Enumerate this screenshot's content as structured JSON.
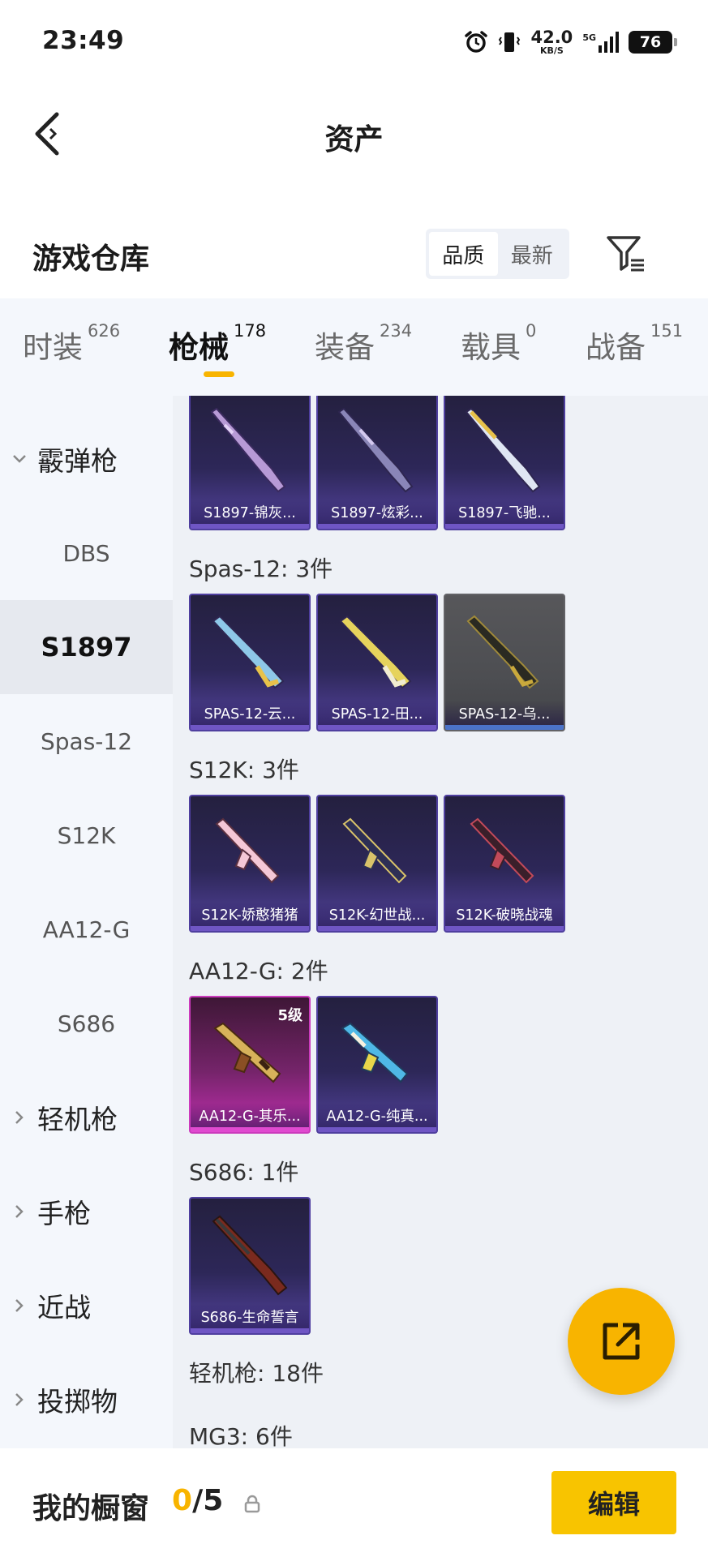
{
  "status_bar": {
    "time": "23:49",
    "net_speed_value": "42.0",
    "net_speed_unit": "KB/S",
    "network": "5G",
    "battery": "76"
  },
  "header": {
    "title": "资产"
  },
  "warehouse": {
    "title": "游戏仓库",
    "sort_options": [
      {
        "label": "品质",
        "active": true
      },
      {
        "label": "最新",
        "active": false
      }
    ]
  },
  "tabs": [
    {
      "label": "时装",
      "count": "626",
      "active": false
    },
    {
      "label": "枪械",
      "count": "178",
      "active": true
    },
    {
      "label": "装备",
      "count": "234",
      "active": false
    },
    {
      "label": "载具",
      "count": "0",
      "active": false
    },
    {
      "label": "战备",
      "count": "151",
      "active": false
    }
  ],
  "sidebar": {
    "groups": [
      {
        "label": "霰弹枪",
        "expanded": true
      },
      {
        "label": "轻机枪",
        "expanded": false
      },
      {
        "label": "手枪",
        "expanded": false
      },
      {
        "label": "近战",
        "expanded": false
      },
      {
        "label": "投掷物",
        "expanded": false
      }
    ],
    "sub_items": [
      {
        "label": "DBS",
        "selected": false
      },
      {
        "label": "S1897",
        "selected": true
      },
      {
        "label": "Spas-12",
        "selected": false
      },
      {
        "label": "S12K",
        "selected": false
      },
      {
        "label": "AA12-G",
        "selected": false
      },
      {
        "label": "S686",
        "selected": false
      }
    ]
  },
  "sections": [
    {
      "label": "",
      "items": [
        {
          "name": "S1897-锦灰...",
          "style": "purple"
        },
        {
          "name": "S1897-炫彩...",
          "style": "purple"
        },
        {
          "name": "S1897-飞驰...",
          "style": "purple"
        }
      ]
    },
    {
      "label": "Spas-12: 3件",
      "items": [
        {
          "name": "SPAS-12-云...",
          "style": "purple"
        },
        {
          "name": "SPAS-12-田...",
          "style": "purple"
        },
        {
          "name": "SPAS-12-乌...",
          "style": "gray"
        }
      ]
    },
    {
      "label": "S12K: 3件",
      "items": [
        {
          "name": "S12K-娇憨猪猪",
          "style": "purple"
        },
        {
          "name": "S12K-幻世战...",
          "style": "purple"
        },
        {
          "name": "S12K-破晓战魂",
          "style": "purple"
        }
      ]
    },
    {
      "label": "AA12-G: 2件",
      "items": [
        {
          "name": "AA12-G-其乐...",
          "style": "pink",
          "level": "5级"
        },
        {
          "name": "AA12-G-纯真...",
          "style": "purple"
        }
      ]
    },
    {
      "label": "S686: 1件",
      "items": [
        {
          "name": "S686-生命誓言",
          "style": "purple"
        }
      ]
    },
    {
      "label": "轻机枪: 18件",
      "items": []
    },
    {
      "label": "MG3: 6件",
      "items": []
    }
  ],
  "bottom_bar": {
    "showcase_label": "我的橱窗",
    "showcase_current": "0",
    "showcase_total": "/5",
    "edit_label": "编辑"
  },
  "colors": {
    "accent": "#f8b400",
    "card_purple": "#2d2758",
    "card_gray": "#4d4e52",
    "card_pink": "#c22fb0"
  }
}
